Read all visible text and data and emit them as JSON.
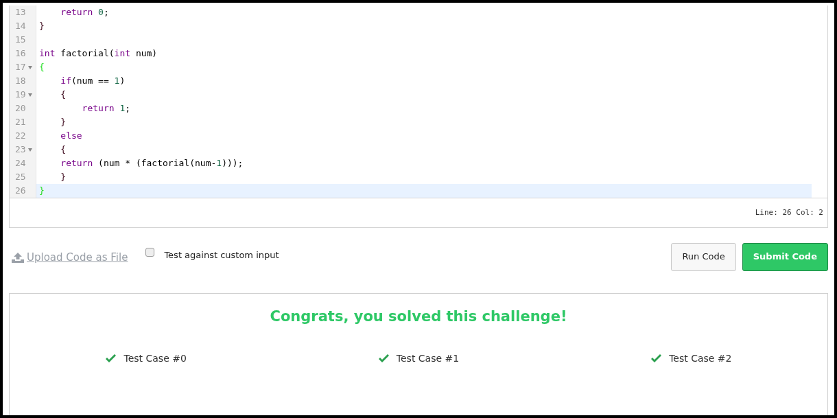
{
  "editor": {
    "lines": [
      {
        "number": "13",
        "foldable": false,
        "active": false,
        "tokens": [
          {
            "kind": "keyword",
            "text": "    return "
          },
          {
            "kind": "number",
            "text": "0"
          },
          {
            "kind": "plain",
            "text": ";"
          }
        ]
      },
      {
        "number": "14",
        "foldable": false,
        "active": false,
        "tokens": [
          {
            "kind": "brace",
            "text": "}"
          }
        ]
      },
      {
        "number": "15",
        "foldable": false,
        "active": false
      },
      {
        "number": "16",
        "foldable": false,
        "active": false,
        "tokens": [
          {
            "kind": "keyword",
            "text": "int"
          },
          {
            "kind": "plain",
            "text": " factorial("
          },
          {
            "kind": "keyword",
            "text": "int"
          },
          {
            "kind": "plain",
            "text": " num)"
          }
        ]
      },
      {
        "number": "17",
        "foldable": true,
        "active": false,
        "tokens": [
          {
            "kind": "brace-match",
            "text": "{"
          }
        ]
      },
      {
        "number": "18",
        "foldable": false,
        "active": false,
        "tokens": [
          {
            "kind": "keyword",
            "text": "    if"
          },
          {
            "kind": "plain",
            "text": "(num == "
          },
          {
            "kind": "number",
            "text": "1"
          },
          {
            "kind": "plain",
            "text": ")"
          }
        ]
      },
      {
        "number": "19",
        "foldable": true,
        "active": false,
        "tokens": [
          {
            "kind": "brace",
            "text": "    {"
          }
        ]
      },
      {
        "number": "20",
        "foldable": false,
        "active": false,
        "tokens": [
          {
            "kind": "keyword",
            "text": "        return "
          },
          {
            "kind": "number",
            "text": "1"
          },
          {
            "kind": "plain",
            "text": ";"
          }
        ]
      },
      {
        "number": "21",
        "foldable": false,
        "active": false,
        "tokens": [
          {
            "kind": "brace",
            "text": "    }"
          }
        ]
      },
      {
        "number": "22",
        "foldable": false,
        "active": false,
        "tokens": [
          {
            "kind": "keyword",
            "text": "    else"
          }
        ]
      },
      {
        "number": "23",
        "foldable": true,
        "active": false,
        "tokens": [
          {
            "kind": "brace",
            "text": "    {"
          }
        ]
      },
      {
        "number": "24",
        "foldable": false,
        "active": false,
        "tokens": [
          {
            "kind": "keyword",
            "text": "    return"
          },
          {
            "kind": "plain",
            "text": " (num * (factorial(num-"
          },
          {
            "kind": "number",
            "text": "1"
          },
          {
            "kind": "plain",
            "text": ")));"
          }
        ]
      },
      {
        "number": "25",
        "foldable": false,
        "active": false,
        "tokens": [
          {
            "kind": "brace",
            "text": "    }"
          }
        ]
      },
      {
        "number": "26",
        "foldable": false,
        "active": true,
        "tokens": [
          {
            "kind": "brace-match",
            "text": "}"
          }
        ]
      }
    ],
    "cursor_position": "Line: 26 Col: 2"
  },
  "actions": {
    "upload_link": "Upload Code as File",
    "custom_input": {
      "label": "Test against custom input",
      "checked": false
    },
    "buttons": [
      {
        "kind": "secondary",
        "label": "Run Code"
      },
      {
        "kind": "primary",
        "label": "Submit Code"
      }
    ]
  },
  "result": {
    "message": "Congrats, you solved this challenge!",
    "test_cases": [
      {
        "label": "Test Case #0",
        "passed": true
      },
      {
        "label": "Test Case #1",
        "passed": true
      },
      {
        "label": "Test Case #2",
        "passed": true
      }
    ]
  }
}
